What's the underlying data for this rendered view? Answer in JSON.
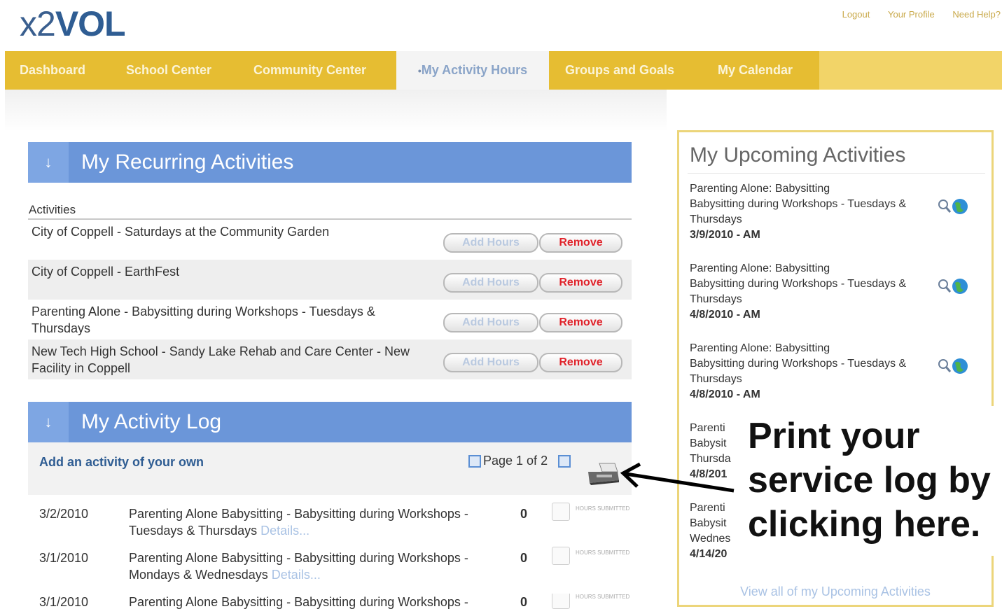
{
  "logo": {
    "prefix": "x2",
    "brand": "VOL"
  },
  "top_links": [
    "Logout",
    "Your Profile",
    "Need Help?"
  ],
  "nav": {
    "items": [
      "Dashboard",
      "School Center",
      "Community Center",
      "My Activity Hours",
      "Groups and Goals",
      "My Calendar"
    ],
    "active_bullet": "•"
  },
  "recurring": {
    "title": "My Recurring Activities",
    "column": "Activities",
    "add_label": "Add Hours",
    "remove_label": "Remove",
    "rows": [
      {
        "text": "City of Coppell - Saturdays at the Community Garden"
      },
      {
        "text": "City of Coppell - EarthFest"
      },
      {
        "text": "Parenting Alone - Babysitting during Workshops - Tuesdays & Thursdays"
      },
      {
        "text": "New Tech High School - Sandy Lake Rehab and Care Center - New Facility in Coppell"
      }
    ]
  },
  "log": {
    "title": "My Activity Log",
    "add_own": "Add an activity of your own",
    "page_text": "Page 1 of 2",
    "details_label": "Details...",
    "submitted_label": "HOURS SUBMITTED",
    "rows": [
      {
        "date": "3/2/2010",
        "desc": "Parenting Alone Babysitting - Babysitting during Workshops - Tuesdays & Thursdays",
        "hours": "0"
      },
      {
        "date": "3/1/2010",
        "desc": "Parenting Alone Babysitting - Babysitting during Workshops - Mondays & Wednesdays",
        "hours": "0"
      },
      {
        "date": "3/1/2010",
        "desc": "Parenting Alone Babysitting - Babysitting during Workshops -",
        "hours": "0"
      }
    ]
  },
  "upcoming": {
    "title": "My Upcoming Activities",
    "items": [
      {
        "l1": "Parenting Alone: Babysitting",
        "l2": "Babysitting during Workshops - Tuesdays &",
        "l3": "Thursdays",
        "date": "3/9/2010 - AM"
      },
      {
        "l1": "Parenting Alone: Babysitting",
        "l2": "Babysitting during Workshops - Tuesdays &",
        "l3": "Thursdays",
        "date": "4/8/2010 - AM"
      },
      {
        "l1": "Parenting Alone: Babysitting",
        "l2": "Babysitting during Workshops - Tuesdays &",
        "l3": "Thursdays",
        "date": "4/8/2010 - AM"
      },
      {
        "l1": "Parenti",
        "l2": "Babysit",
        "l3": "Thursda",
        "date": "4/8/201"
      },
      {
        "l1": "Parenti",
        "l2": "Babysit",
        "l3": "Wednes",
        "date": "4/14/20"
      }
    ],
    "view_all": "View all of my Upcoming Activities"
  },
  "callout": {
    "line1": "Print your",
    "line2": "service log by",
    "line3": "clicking here."
  }
}
